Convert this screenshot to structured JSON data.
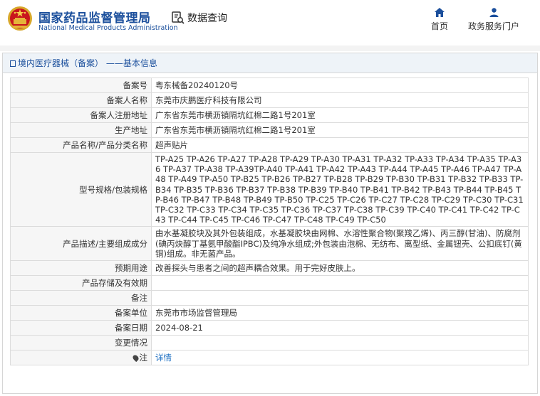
{
  "header": {
    "title_cn": "国家药品监督管理局",
    "title_en": "National Medical Products Administration",
    "search_label": "数据查询",
    "nav": [
      {
        "label": "首页",
        "icon": "home-icon"
      },
      {
        "label": "政务服务门户",
        "icon": "user-icon"
      }
    ]
  },
  "panel": {
    "breadcrumb": "境内医疗器械（备案）",
    "breadcrumb_suffix": " ——基本信息"
  },
  "record": {
    "rows": [
      {
        "label": "备案号",
        "value": "粤东械备20240120号"
      },
      {
        "label": "备案人名称",
        "value": "东莞市庆鹏医疗科技有限公司"
      },
      {
        "label": "备案人注册地址",
        "value": "广东省东莞市横沥镇隔坑红棉二路1号201室"
      },
      {
        "label": "生产地址",
        "value": "广东省东莞市横沥镇隔坑红棉二路1号201室"
      },
      {
        "label": "产品名称/产品分类名称",
        "value": "超声贴片"
      },
      {
        "label": "型号规格/包装规格",
        "value": "TP-A25 TP-A26 TP-A27 TP-A28 TP-A29 TP-A30 TP-A31 TP-A32 TP-A33 TP-A34 TP-A35 TP-A36 TP-A37 TP-A38 TP-A39TP-A40 TP-A41 TP-A42 TP-A43 TP-A44 TP-A45 TP-A46 TP-A47 TP-A48 TP-A49 TP-A50 TP-B25 TP-B26 TP-B27 TP-B28 TP-B29 TP-B30 TP-B31 TP-B32 TP-B33 TP-B34 TP-B35 TP-B36 TP-B37 TP-B38 TP-B39 TP-B40 TP-B41 TP-B42 TP-B43 TP-B44 TP-B45 TP-B46 TP-B47 TP-B48 TP-B49 TP-B50 TP-C25 TP-C26 TP-C27 TP-C28 TP-C29 TP-C30 TP-C31 TP-C32 TP-C33 TP-C34 TP-C35 TP-C36 TP-C37 TP-C38 TP-C39 TP-C40 TP-C41 TP-C42 TP-C43 TP-C44 TP-C45 TP-C46 TP-C47 TP-C48 TP-C49 TP-C50"
      },
      {
        "label": "产品描述/主要组成成分",
        "value": "由水基凝胶块及其外包装组成，水基凝胶块由网棉、水溶性聚合物(聚羧乙烯)、丙三醇(甘油)、防腐剂(碘丙炔醇丁基氨甲酸酯IPBC)及纯净水组成;外包装由泡棉、无纺布、离型纸、金属钮壳、公扣底钉(黄铜)组成。非无菌产品。"
      },
      {
        "label": "预期用途",
        "value": "改善探头与患者之间的超声耦合效果。用于完好皮肤上。"
      },
      {
        "label": "产品存储及有效期",
        "value": ""
      },
      {
        "label": "备注",
        "value": ""
      },
      {
        "label": "备案单位",
        "value": "东莞市市场监督管理局"
      },
      {
        "label": "备案日期",
        "value": "2024-08-21"
      },
      {
        "label": "变更情况",
        "value": ""
      }
    ],
    "note_label": "注",
    "note_link": "详情"
  }
}
